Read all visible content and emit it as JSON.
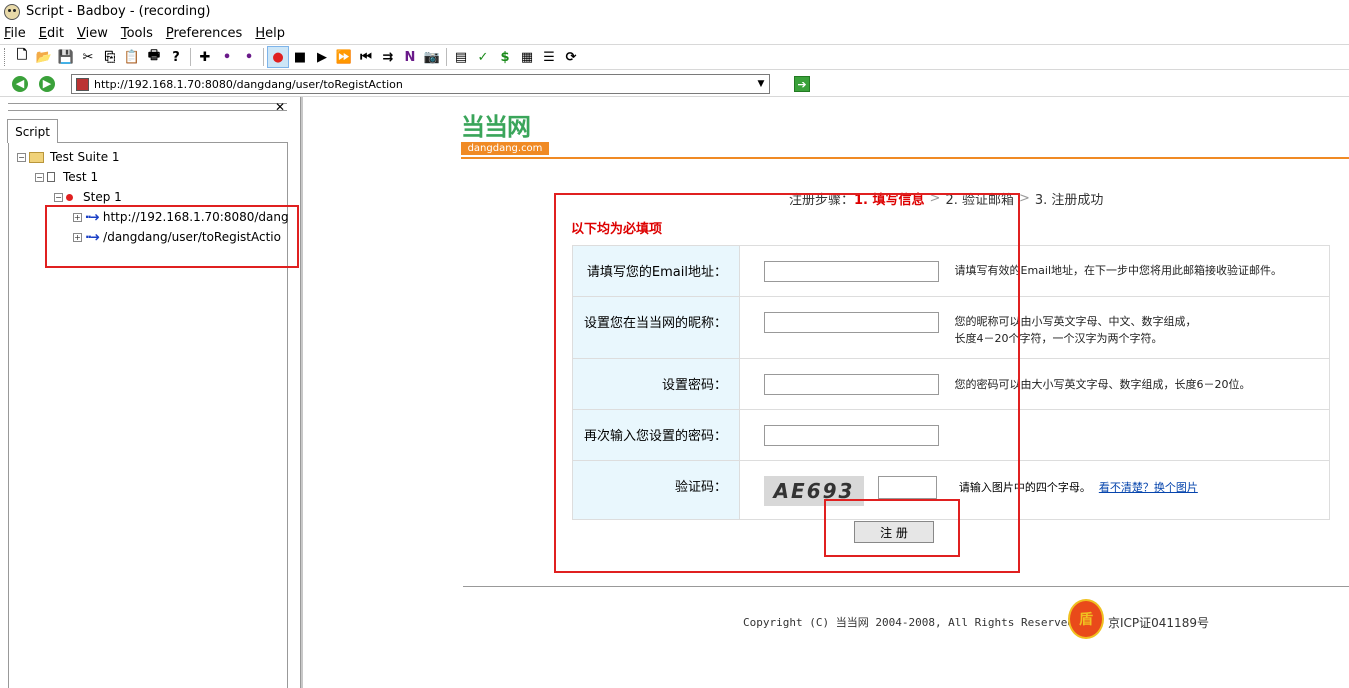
{
  "window": {
    "title": "Script - Badboy - (recording)"
  },
  "menu": [
    {
      "label": "File",
      "key": "F",
      "rest": "ile"
    },
    {
      "label": "Edit",
      "key": "E",
      "rest": "dit"
    },
    {
      "label": "View",
      "key": "V",
      "rest": "iew"
    },
    {
      "label": "Tools",
      "key": "T",
      "rest": "ools"
    },
    {
      "label": "Preferences",
      "key": "P",
      "rest": "references"
    },
    {
      "label": "Help",
      "key": "H",
      "rest": "elp"
    }
  ],
  "toolbar": {
    "icons": [
      "new-icon",
      "open-icon",
      "save-icon",
      "cut-icon",
      "copy-icon",
      "paste-icon",
      "print-icon",
      "help-icon",
      "new-suite-icon",
      "add-test-icon",
      "add-step-icon",
      "record-icon",
      "stop-icon",
      "play-icon",
      "play-all-icon",
      "rewind-icon",
      "navigate-icon",
      "n-icon",
      "camera-icon",
      "report-icon",
      "check-icon",
      "dollar-icon",
      "grid-icon",
      "list-icon",
      "refresh-icon"
    ],
    "glyphs": [
      "🗋",
      "📂",
      "💾",
      "✂",
      "⎘",
      "📋",
      "🖶",
      "?",
      "✚",
      "•",
      "•",
      "●",
      "■",
      "▶",
      "⏩",
      "⏮",
      "⇉",
      "N",
      "📷",
      "▤",
      "✓",
      "$",
      "▦",
      "☰",
      "⟳"
    ],
    "colors": {
      "record": "#e02020",
      "check": "#1a8a1a",
      "dollar": "#1a8a1a",
      "n": "#6a1a8a"
    }
  },
  "address": {
    "url": "http://192.168.1.70:8080/dangdang/user/toRegistAction"
  },
  "left_panel": {
    "tab_label": "Script",
    "tree": {
      "suite": "Test Suite 1",
      "test": "Test 1",
      "step": "Step 1",
      "requests": [
        "http://192.168.1.70:8080/dango",
        "/dangdang/user/toRegistActio"
      ]
    }
  },
  "page": {
    "logo": {
      "cn": "当当网",
      "en": "dangdang.com"
    },
    "steps": {
      "prefix": "注册步骤：",
      "step1": "1. 填写信息",
      "step2": "2. 验证邮箱",
      "step3": "3. 注册成功",
      "sep": ">"
    },
    "required_note": "以下均为必填项",
    "fields": [
      {
        "label": "请填写您的Email地址：",
        "hint": "请填写有效的Email地址，在下一步中您将用此邮箱接收验证邮件。"
      },
      {
        "label": "设置您在当当网的昵称：",
        "hint": "您的昵称可以由小写英文字母、中文、数字组成，",
        "hint2": "长度4－20个字符，一个汉字为两个字符。"
      },
      {
        "label": "设置密码：",
        "hint": "您的密码可以由大小写英文字母、数字组成，长度6－20位。"
      },
      {
        "label": "再次输入您设置的密码：",
        "hint": ""
      },
      {
        "label": "验证码：",
        "captcha_text": "AE693",
        "hint": "请输入图片中的四个字母。",
        "link": "看不清楚？换个图片"
      }
    ],
    "register_button": "注 册",
    "footer": {
      "copyright": "Copyright (C) 当当网 2004-2008, All Rights Reserved",
      "badge": "盾",
      "icp": "京ICP证041189号"
    }
  }
}
